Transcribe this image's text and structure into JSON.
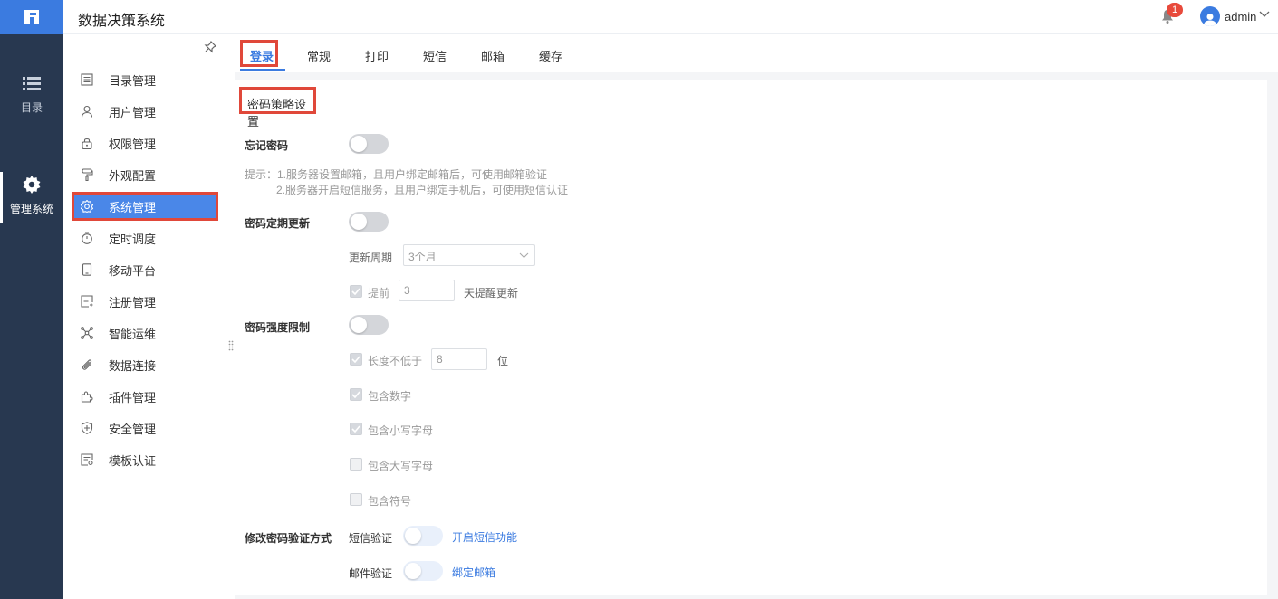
{
  "app": {
    "title": "数据决策系统"
  },
  "rail": {
    "items": [
      {
        "label": "目录",
        "icon": "list-icon"
      },
      {
        "label": "管理系统",
        "icon": "gear-icon",
        "active": true
      }
    ]
  },
  "header": {
    "notification_count": "1",
    "username": "admin"
  },
  "subnav": {
    "items": [
      {
        "label": "目录管理",
        "icon": "catalog-icon"
      },
      {
        "label": "用户管理",
        "icon": "user-icon"
      },
      {
        "label": "权限管理",
        "icon": "lock-icon"
      },
      {
        "label": "外观配置",
        "icon": "paint-roller-icon"
      },
      {
        "label": "系统管理",
        "icon": "gear-icon",
        "active": true
      },
      {
        "label": "定时调度",
        "icon": "timer-icon"
      },
      {
        "label": "移动平台",
        "icon": "mobile-icon"
      },
      {
        "label": "注册管理",
        "icon": "register-icon"
      },
      {
        "label": "智能运维",
        "icon": "network-icon"
      },
      {
        "label": "数据连接",
        "icon": "paperclip-icon"
      },
      {
        "label": "插件管理",
        "icon": "puzzle-icon"
      },
      {
        "label": "安全管理",
        "icon": "shield-icon"
      },
      {
        "label": "模板认证",
        "icon": "certificate-icon"
      }
    ]
  },
  "tabs": [
    {
      "label": "登录",
      "active": true
    },
    {
      "label": "常规"
    },
    {
      "label": "打印"
    },
    {
      "label": "短信"
    },
    {
      "label": "邮箱"
    },
    {
      "label": "缓存"
    }
  ],
  "panel": {
    "section_title": "密码策略设置",
    "forgot_password": {
      "label": "忘记密码",
      "enabled": false
    },
    "hint_line1": "提示：1.服务器设置邮箱，且用户绑定邮箱后，可使用邮箱验证",
    "hint_line2": "2.服务器开启短信服务，且用户绑定手机后，可使用短信认证",
    "periodic_update": {
      "label": "密码定期更新",
      "enabled": false,
      "period_label": "更新周期",
      "period_value": "3个月",
      "remind_label": "提前",
      "remind_value": "3",
      "remind_suffix": "天提醒更新",
      "remind_checked": true
    },
    "strength": {
      "label": "密码强度限制",
      "enabled": false,
      "min_length_label": "长度不低于",
      "min_length_value": "8",
      "min_length_suffix": "位",
      "min_length_checked": true,
      "digits_label": "包含数字",
      "digits_checked": true,
      "lowercase_label": "包含小写字母",
      "lowercase_checked": true,
      "uppercase_label": "包含大写字母",
      "uppercase_checked": false,
      "symbols_label": "包含符号",
      "symbols_checked": false
    },
    "change_verify": {
      "label": "修改密码验证方式",
      "sms_label": "短信验证",
      "sms_enabled": false,
      "sms_link": "开启短信功能",
      "email_label": "邮件验证",
      "email_enabled": false,
      "email_link": "绑定邮箱"
    }
  },
  "colors": {
    "accent": "#3b7be0",
    "rail_bg": "#283850",
    "highlight_box": "#e0483a"
  }
}
